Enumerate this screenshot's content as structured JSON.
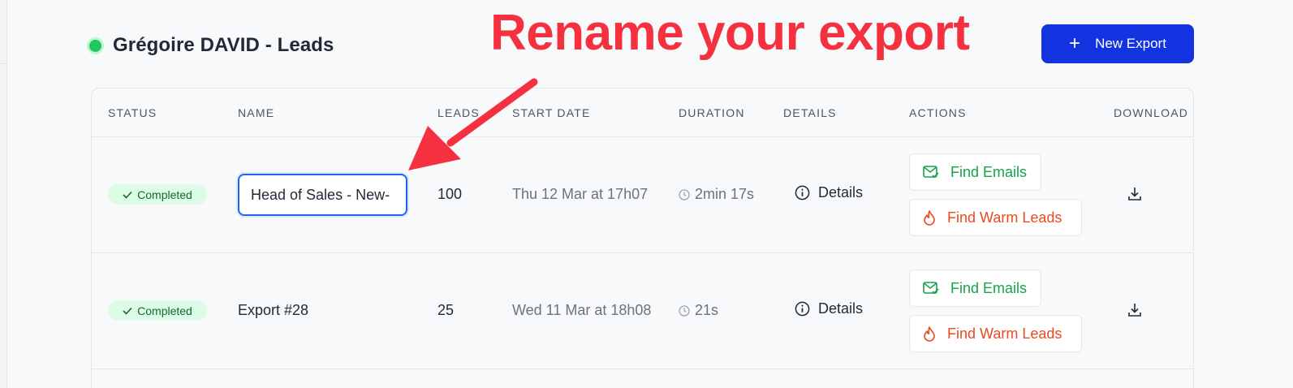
{
  "header": {
    "title": "Grégoire DAVID - Leads",
    "status_color": "#22c55e"
  },
  "annotation": {
    "text": "Rename your export",
    "color": "#f5313f"
  },
  "new_export": {
    "label": "New Export",
    "icon": "plus-icon",
    "color": "#1433e0"
  },
  "table": {
    "columns": [
      "STATUS",
      "NAME",
      "LEADS",
      "START DATE",
      "DURATION",
      "DETAILS",
      "ACTIONS",
      "DOWNLOAD"
    ],
    "rows": [
      {
        "status": "Completed",
        "name": "Head of Sales - New-",
        "name_editing": true,
        "leads": "100",
        "start_date": "Thu 12 Mar at 17h07",
        "duration": "2min 17s",
        "details": "Details",
        "find_emails": "Find Emails",
        "find_warm_leads": "Find Warm Leads"
      },
      {
        "status": "Completed",
        "name": "Export #28",
        "name_editing": false,
        "leads": "25",
        "start_date": "Wed 11 Mar at 18h08",
        "duration": "21s",
        "details": "Details",
        "find_emails": "Find Emails",
        "find_warm_leads": "Find Warm Leads"
      }
    ]
  },
  "colors": {
    "completed_badge_bg": "#dcfce7",
    "completed_badge_text": "#166534",
    "find_emails": "#16a34a",
    "find_warm_leads": "#ea4a1f",
    "input_focus": "#2563eb"
  }
}
